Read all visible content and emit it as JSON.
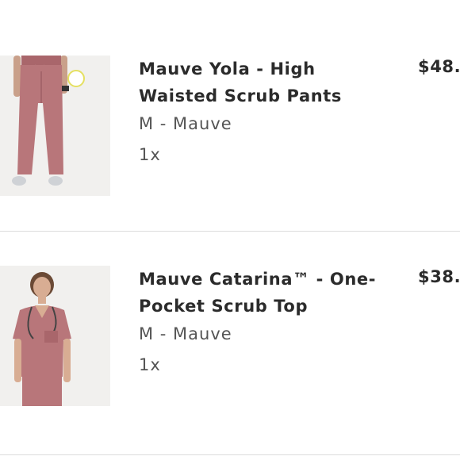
{
  "cart": {
    "items": [
      {
        "title": "Mauve Yola - High Waisted Scrub Pants",
        "variant": "M - Mauve",
        "quantity": "1x",
        "price": "$48.",
        "image_icon": "scrub-pants-photo"
      },
      {
        "title": "Mauve Catarina™ - One-Pocket Scrub Top",
        "variant": "M - Mauve",
        "quantity": "1x",
        "price": "$38.",
        "image_icon": "scrub-top-photo"
      }
    ],
    "colors": {
      "mauve": "#b8767a",
      "text": "#2b2b2b",
      "muted": "#555555",
      "divider": "#dcdcdc"
    }
  }
}
